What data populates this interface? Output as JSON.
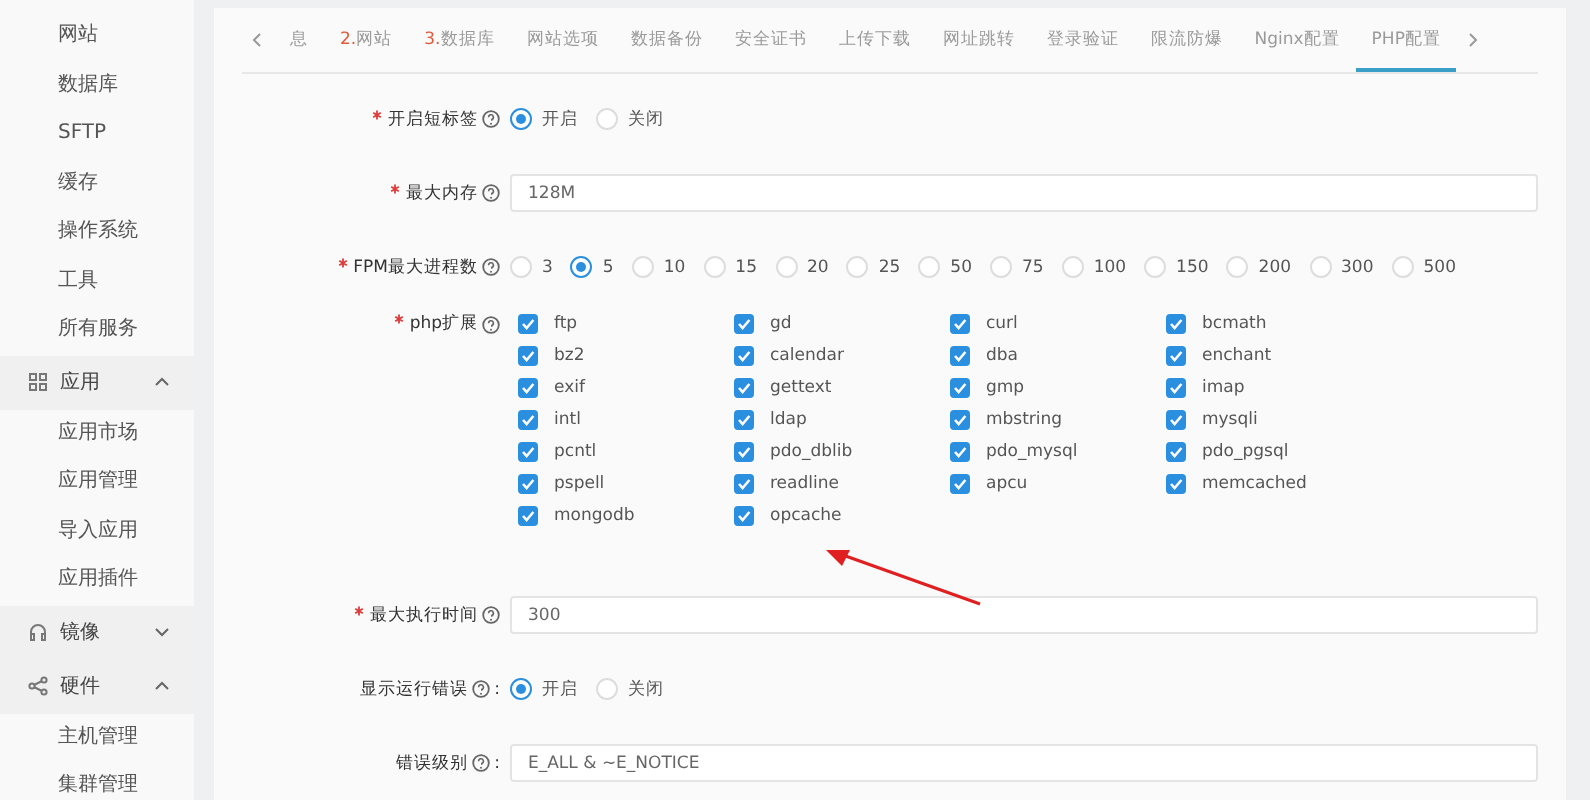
{
  "sidebar": {
    "items": [
      {
        "label": "网站",
        "kind": "item"
      },
      {
        "label": "数据库",
        "kind": "item"
      },
      {
        "label": "SFTP",
        "kind": "item"
      },
      {
        "label": "缓存",
        "kind": "item"
      },
      {
        "label": "操作系统",
        "kind": "item"
      },
      {
        "label": "工具",
        "kind": "item"
      },
      {
        "label": "所有服务",
        "kind": "item"
      },
      {
        "label": "应用",
        "kind": "group",
        "expanded": true
      },
      {
        "label": "应用市场",
        "kind": "item"
      },
      {
        "label": "应用管理",
        "kind": "item"
      },
      {
        "label": "导入应用",
        "kind": "item"
      },
      {
        "label": "应用插件",
        "kind": "item"
      },
      {
        "label": "镜像",
        "kind": "group",
        "expanded": false
      },
      {
        "label": "硬件",
        "kind": "group",
        "expanded": true
      },
      {
        "label": "主机管理",
        "kind": "item"
      },
      {
        "label": "集群管理",
        "kind": "item"
      }
    ]
  },
  "tabs": [
    {
      "label": "息",
      "selected": false
    },
    {
      "number": "2.",
      "label": "网站",
      "selected": false
    },
    {
      "number": "3.",
      "label": "数据库",
      "selected": false
    },
    {
      "label": "网站选项",
      "selected": false
    },
    {
      "label": "数据备份",
      "selected": false
    },
    {
      "label": "安全证书",
      "selected": false
    },
    {
      "label": "上传下载",
      "selected": false
    },
    {
      "label": "网址跳转",
      "selected": false
    },
    {
      "label": "登录验证",
      "selected": false
    },
    {
      "label": "限流防爆",
      "selected": false
    },
    {
      "label": "Nginx配置",
      "selected": false
    },
    {
      "label": "PHP配置",
      "selected": true
    }
  ],
  "form": [
    {
      "kind": "radio",
      "label": "开启短标签",
      "required": true,
      "options": [
        {
          "label": "开启",
          "selected": true
        },
        {
          "label": "关闭",
          "selected": false
        }
      ]
    },
    {
      "kind": "input",
      "label": "最大内存",
      "required": true,
      "value": "128M"
    },
    {
      "kind": "radio",
      "label": "FPM最大进程数",
      "required": true,
      "options": [
        {
          "label": "3",
          "selected": false
        },
        {
          "label": "5",
          "selected": true
        },
        {
          "label": "10",
          "selected": false
        },
        {
          "label": "15",
          "selected": false
        },
        {
          "label": "20",
          "selected": false
        },
        {
          "label": "25",
          "selected": false
        },
        {
          "label": "50",
          "selected": false
        },
        {
          "label": "75",
          "selected": false
        },
        {
          "label": "100",
          "selected": false
        },
        {
          "label": "150",
          "selected": false
        },
        {
          "label": "200",
          "selected": false
        },
        {
          "label": "300",
          "selected": false
        },
        {
          "label": "500",
          "selected": false
        }
      ]
    },
    {
      "kind": "checkboxes",
      "label": "php扩展",
      "required": true,
      "options": [
        {
          "label": "ftp",
          "checked": true
        },
        {
          "label": "gd",
          "checked": true
        },
        {
          "label": "curl",
          "checked": true
        },
        {
          "label": "bcmath",
          "checked": true
        },
        {
          "label": "bz2",
          "checked": true
        },
        {
          "label": "calendar",
          "checked": true
        },
        {
          "label": "dba",
          "checked": true
        },
        {
          "label": "enchant",
          "checked": true
        },
        {
          "label": "exif",
          "checked": true
        },
        {
          "label": "gettext",
          "checked": true
        },
        {
          "label": "gmp",
          "checked": true
        },
        {
          "label": "imap",
          "checked": true
        },
        {
          "label": "intl",
          "checked": true
        },
        {
          "label": "ldap",
          "checked": true
        },
        {
          "label": "mbstring",
          "checked": true
        },
        {
          "label": "mysqli",
          "checked": true
        },
        {
          "label": "pcntl",
          "checked": true
        },
        {
          "label": "pdo_dblib",
          "checked": true
        },
        {
          "label": "pdo_mysql",
          "checked": true
        },
        {
          "label": "pdo_pgsql",
          "checked": true
        },
        {
          "label": "pspell",
          "checked": true
        },
        {
          "label": "readline",
          "checked": true
        },
        {
          "label": "apcu",
          "checked": true
        },
        {
          "label": "memcached",
          "checked": true
        },
        {
          "label": "mongodb",
          "checked": true
        },
        {
          "label": "opcache",
          "checked": true
        }
      ]
    },
    {
      "kind": "input",
      "label": "最大执行时间",
      "required": true,
      "value": "300"
    },
    {
      "kind": "radio",
      "label": "显示运行错误",
      "required": false,
      "colon": ":",
      "options": [
        {
          "label": "开启",
          "selected": true
        },
        {
          "label": "关闭",
          "selected": false
        }
      ]
    },
    {
      "kind": "input",
      "label": "错误级别",
      "required": false,
      "colon": ":",
      "value": "E_ALL & ~E_NOTICE"
    }
  ]
}
